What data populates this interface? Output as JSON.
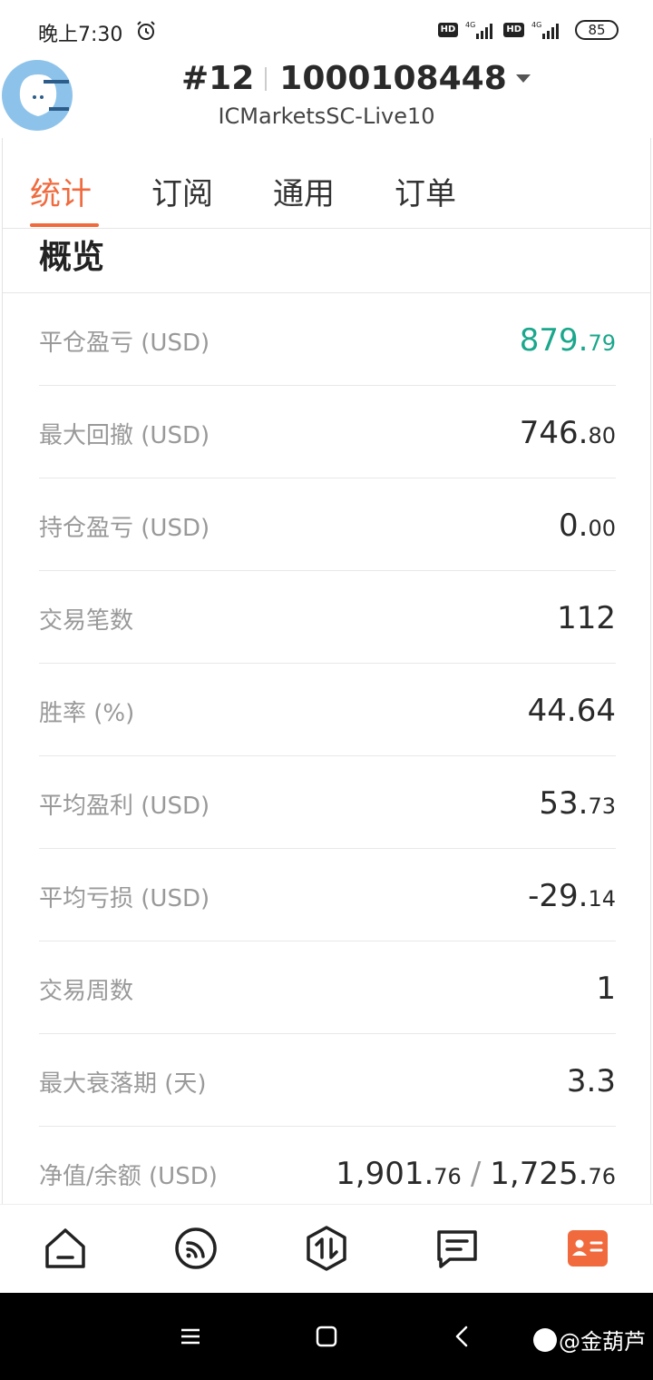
{
  "status_bar": {
    "time": "晚上7:30",
    "hd1": "HD",
    "hd2": "HD",
    "net1": "4G",
    "net2": "4G",
    "battery": "85"
  },
  "header": {
    "account_no": "#12",
    "account_id": "1000108448",
    "server": "ICMarketsSC-Live10"
  },
  "tabs": [
    {
      "label": "统计",
      "active": true
    },
    {
      "label": "订阅",
      "active": false
    },
    {
      "label": "通用",
      "active": false
    },
    {
      "label": "订单",
      "active": false
    }
  ],
  "section_title": "概览",
  "stats": [
    {
      "label": "平仓盈亏 (USD)",
      "int": "879.",
      "dec": "79",
      "color": "#1aa78c"
    },
    {
      "label": "最大回撤 (USD)",
      "int": "746.",
      "dec": "80"
    },
    {
      "label": "持仓盈亏 (USD)",
      "int": "0.",
      "dec": "00"
    },
    {
      "label": "交易笔数",
      "int": "112",
      "dec": ""
    },
    {
      "label": "胜率 (%)",
      "int": "44.64",
      "dec": ""
    },
    {
      "label": "平均盈利 (USD)",
      "int": "53.",
      "dec": "73"
    },
    {
      "label": "平均亏损 (USD)",
      "int": "-29.",
      "dec": "14"
    },
    {
      "label": "交易周数",
      "int": "1",
      "dec": ""
    },
    {
      "label": "最大衰落期 (天)",
      "int": "3.3",
      "dec": ""
    },
    {
      "label": "净值/余额 (USD)",
      "int": "1,901.",
      "dec": "76",
      "int2": "1,725.",
      "dec2": "76",
      "separator": "/"
    }
  ],
  "bottom_nav": [
    "home-icon",
    "signal-icon",
    "trade-icon",
    "message-icon",
    "profile-card-icon"
  ],
  "accent_color": "#f06a3d",
  "watermark": "@金葫芦"
}
